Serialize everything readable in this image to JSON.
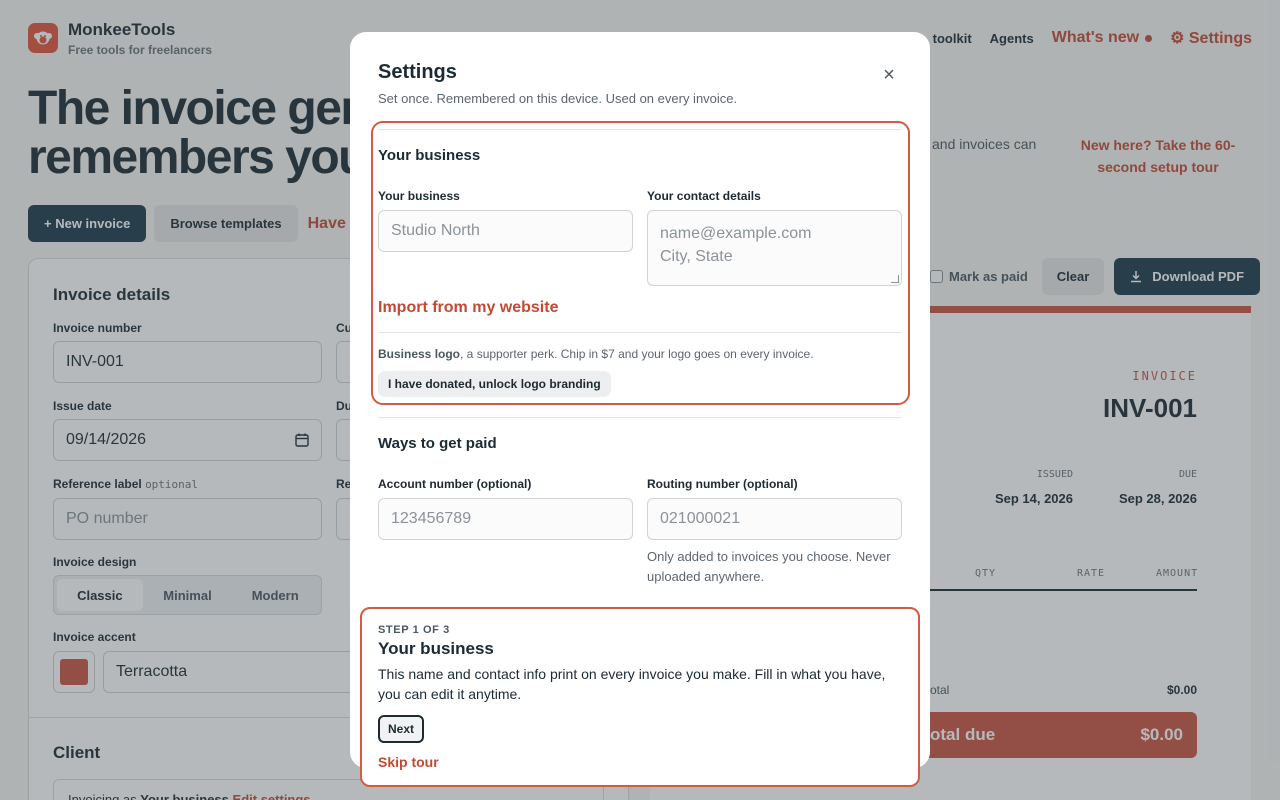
{
  "brand": {
    "name": "MonkeeTools",
    "tagline": "Free tools for freelancers",
    "logo_icon": "monkey-icon",
    "accent": "#e0553b"
  },
  "nav": {
    "partial_item": "toolkit",
    "agents": "Agents",
    "whats_new": "What's new",
    "settings": "⚙ Settings"
  },
  "hero": {
    "line1": "The invoice gen",
    "line2": "remembers you",
    "right_text": "and invoices can",
    "tour_link": "New here? Take the 60-second setup tour"
  },
  "actions": {
    "new_invoice": "+ New invoice",
    "browse_templates": "Browse templates",
    "have_link": "Have"
  },
  "invoice_form": {
    "title": "Invoice details",
    "invoice_number_label": "Invoice number",
    "invoice_number": "INV-001",
    "cu_label": "Cu",
    "issue_date_label": "Issue date",
    "issue_date": "09/14/2026",
    "du_label": "Du",
    "reference_label": "Reference label",
    "reference_optional": "optional",
    "reference_placeholder": "PO number",
    "re_label": "Re",
    "design_label": "Invoice design",
    "designs": [
      "Classic",
      "Minimal",
      "Modern"
    ],
    "accent_label": "Invoice accent",
    "accent_name": "Terracotta",
    "accent_color": "#c8553f",
    "client_title": "Client",
    "client_text": "Invoicing as",
    "client_business": "Your business",
    "edit_settings": "Edit settings"
  },
  "preview": {
    "mark_paid": "Mark as paid",
    "clear": "Clear",
    "download": "Download PDF",
    "invoice_label": "INVOICE",
    "invoice_number": "INV-001",
    "issued_label": "ISSUED",
    "issued": "Sep 14, 2026",
    "due_label": "DUE",
    "due": "Sep 28, 2026",
    "col_qty": "QTY",
    "col_rate": "RATE",
    "col_amount": "AMOUNT",
    "subtotal_label": "otal",
    "subtotal": "$0.00",
    "total_label": "otal due",
    "total": "$0.00"
  },
  "modal": {
    "title": "Settings",
    "subtitle": "Set once. Remembered on this device. Used on every invoice.",
    "business_section": "Your business",
    "business_label": "Your business",
    "business_placeholder": "Studio North",
    "contact_label": "Your contact details",
    "contact_placeholder_1": "name@example.com",
    "contact_placeholder_2": "City, State",
    "import_link": "Import from my website",
    "logo_bold": "Business logo",
    "logo_rest": ", a supporter perk. Chip in $7 and your logo goes on every invoice.",
    "donate_button": "I have donated, unlock logo branding",
    "payment_section": "Ways to get paid",
    "account_label": "Account number (optional)",
    "account_placeholder": "123456789",
    "routing_label": "Routing number (optional)",
    "routing_placeholder": "021000021",
    "bank_helper": "Only added to invoices you choose. Never uploaded anywhere."
  },
  "tour": {
    "step": "STEP 1 OF 3",
    "title": "Your business",
    "body": "This name and contact info print on every invoice you make. Fill in what you have, you can edit it anytime.",
    "next": "Next",
    "skip": "Skip tour"
  }
}
